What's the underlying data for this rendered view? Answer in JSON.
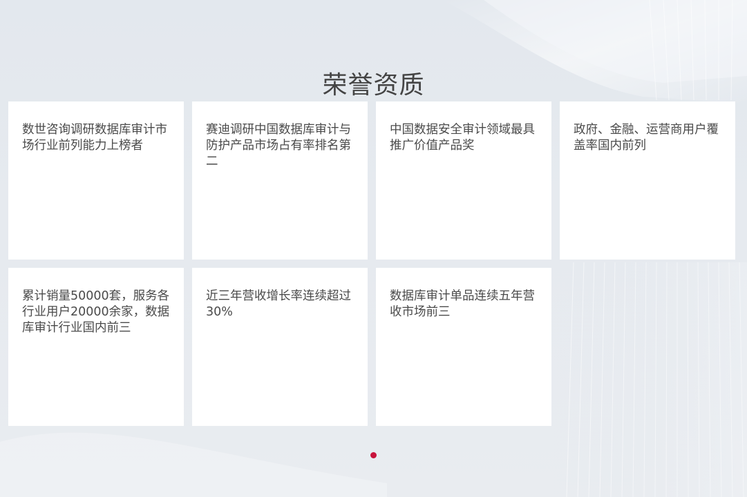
{
  "section": {
    "title": "荣誉资质"
  },
  "cards": [
    {
      "text": "数世咨询调研数据库审计市场行业前列能力上榜者"
    },
    {
      "text": "赛迪调研中国数据库审计与防护产品市场占有率排名第二"
    },
    {
      "text": "中国数据安全审计领域最具推广价值产品奖"
    },
    {
      "text": "政府、金融、运营商用户覆盖率国内前列"
    },
    {
      "text": "累计销量50000套，服务各行业用户20000余家，数据库审计行业国内前三"
    },
    {
      "text": "近三年营收增长率连续超过30%"
    },
    {
      "text": "数据库审计单品连续五年营收市场前三"
    }
  ],
  "pagination": {
    "active_color": "#c8143c"
  },
  "colors": {
    "background": "#e6eaef",
    "card_background": "#ffffff",
    "title_text": "#444444",
    "card_text": "#4a4a4a",
    "accent": "#c8143c"
  }
}
